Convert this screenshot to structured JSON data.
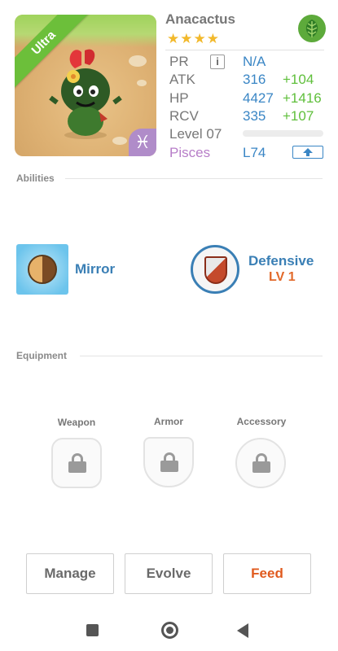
{
  "monster": {
    "name": "Anacactus",
    "rarity_label": "Ultra",
    "stars": "★★★★",
    "element_icon": "leaf-icon",
    "zodiac_symbol": "♓"
  },
  "stats": {
    "pr": {
      "label": "PR",
      "value": "N/A"
    },
    "atk": {
      "label": "ATK",
      "value": "316",
      "bonus": "+104"
    },
    "hp": {
      "label": "HP",
      "value": "4427",
      "bonus": "+1416"
    },
    "rcv": {
      "label": "RCV",
      "value": "335",
      "bonus": "+107"
    },
    "level": {
      "label": "Level 07",
      "progress": 0
    },
    "zodiac": {
      "label": "Pisces",
      "value": "L74"
    }
  },
  "abilities": {
    "title": "Abilities",
    "items": [
      {
        "name": "Mirror",
        "icon": "mirror-ability-icon"
      },
      {
        "name": "Defensive",
        "level": "LV 1",
        "icon": "defensive-shield-icon"
      }
    ]
  },
  "equipment": {
    "title": "Equipment",
    "slots": [
      {
        "label": "Weapon",
        "state": "locked"
      },
      {
        "label": "Armor",
        "state": "locked"
      },
      {
        "label": "Accessory",
        "state": "locked"
      }
    ]
  },
  "actions": {
    "manage": "Manage",
    "evolve": "Evolve",
    "feed": "Feed"
  },
  "colors": {
    "accent_blue": "#3a86c5",
    "bonus_green": "#5fbf3b",
    "feed_orange": "#e05a1e",
    "rarity_green": "#6cbf3a",
    "zodiac_purple": "#b77ec8"
  },
  "navbar": {
    "icons": [
      "recents-icon",
      "home-icon",
      "back-icon"
    ]
  }
}
